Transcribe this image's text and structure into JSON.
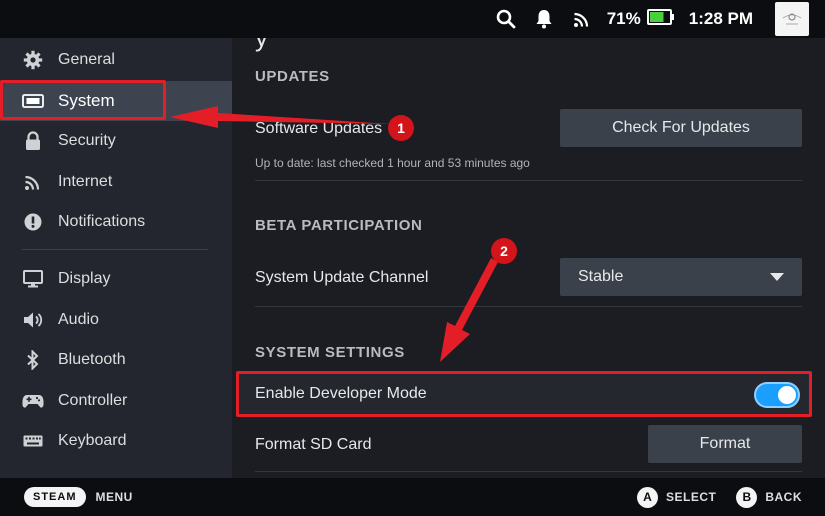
{
  "status_bar": {
    "battery_percent": "71%",
    "battery_level": 0.71,
    "time": "1:28 PM",
    "icons": [
      "search-icon",
      "notification-bell-icon",
      "wireless-signal-icon",
      "battery-icon"
    ]
  },
  "sidebar": {
    "items": [
      {
        "label": "General",
        "icon": "gear-icon"
      },
      {
        "label": "System",
        "icon": "system-icon"
      },
      {
        "label": "Security",
        "icon": "lock-icon"
      },
      {
        "label": "Internet",
        "icon": "wifi-icon"
      },
      {
        "label": "Notifications",
        "icon": "alert-icon"
      },
      {
        "label": "Display",
        "icon": "monitor-icon"
      },
      {
        "label": "Audio",
        "icon": "speaker-icon"
      },
      {
        "label": "Bluetooth",
        "icon": "bluetooth-icon"
      },
      {
        "label": "Controller",
        "icon": "gamepad-icon"
      },
      {
        "label": "Keyboard",
        "icon": "keyboard-icon"
      }
    ],
    "active": "System"
  },
  "main": {
    "partial_heading": "y",
    "updates": {
      "title": "UPDATES",
      "software_updates_label": "Software Updates",
      "check_button": "Check For Updates",
      "status": "Up to date: last checked 1 hour and 53 minutes ago"
    },
    "beta": {
      "title": "BETA PARTICIPATION",
      "channel_label": "System Update Channel",
      "channel_value": "Stable"
    },
    "system_settings": {
      "title": "SYSTEM SETTINGS",
      "dev_mode_label": "Enable Developer Mode",
      "dev_mode_on": true,
      "format_sd_label": "Format SD Card",
      "format_button": "Format"
    }
  },
  "bottom_bar": {
    "steam_label": "STEAM",
    "menu_label": "MENU",
    "select_key": "A",
    "select_label": "SELECT",
    "back_key": "B",
    "back_label": "BACK"
  },
  "annotations": {
    "badge_1": "1",
    "badge_2": "2",
    "color": "#e31e26"
  },
  "colors": {
    "accent": "#1a9fff",
    "annotation": "#e31e26",
    "battery_green": "#4ad03c"
  }
}
